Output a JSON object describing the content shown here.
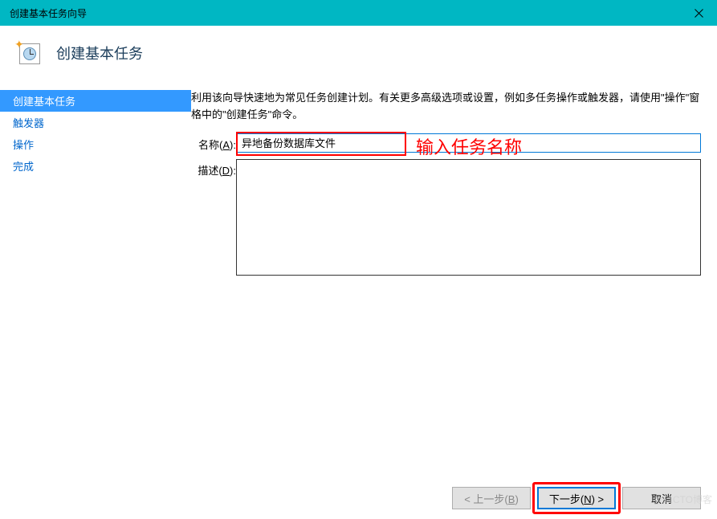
{
  "window": {
    "title": "创建基本任务向导"
  },
  "header": {
    "page_title": "创建基本任务"
  },
  "steps": [
    {
      "label": "创建基本任务",
      "active": true
    },
    {
      "label": "触发器",
      "active": false
    },
    {
      "label": "操作",
      "active": false
    },
    {
      "label": "完成",
      "active": false
    }
  ],
  "content": {
    "intro": "利用该向导快速地为常见任务创建计划。有关更多高级选项或设置，例如多任务操作或触发器，请使用\"操作\"窗格中的\"创建任务\"命令。",
    "name_label": "名称(A):",
    "name_value": "异地备份数据库文件",
    "desc_label": "描述(D):",
    "desc_value": ""
  },
  "annotation": {
    "text": "输入任务名称"
  },
  "buttons": {
    "back": "< 上一步(B)",
    "next": "下一步(N) >",
    "cancel": "取消"
  },
  "watermark": "@51CTO博客"
}
